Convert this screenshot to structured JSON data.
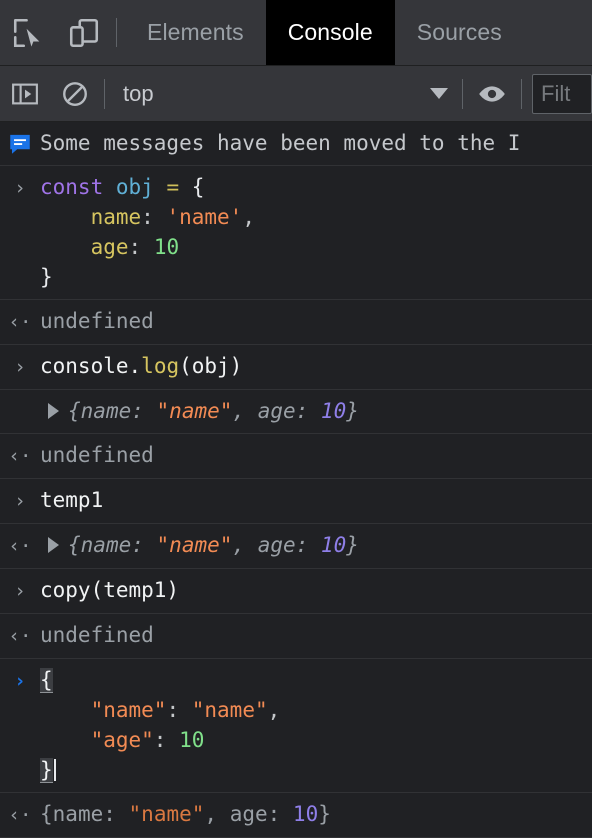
{
  "theme": {
    "bg": "#202124",
    "toolbar_bg": "#35363a",
    "selected_tab_bg": "#000000",
    "accent_blue": "#1a73e8",
    "string_orange": "#f28b54",
    "number_green": "#80e08a",
    "number_purple": "#8f7fe8",
    "key_yellow": "#d6c560",
    "keyword_purple": "#a074e8",
    "variable_blue": "#60b0d6",
    "muted_grey": "#9aa0a6",
    "row_divider": "#313235"
  },
  "tabbar": {
    "icons": [
      {
        "name": "inspect-element-icon",
        "title": "Inspect element"
      },
      {
        "name": "device-toolbar-icon",
        "title": "Toggle device toolbar"
      }
    ],
    "tabs": [
      {
        "label": "Elements",
        "selected": false
      },
      {
        "label": "Console",
        "selected": true
      },
      {
        "label": "Sources",
        "selected": false
      }
    ]
  },
  "toolbar": {
    "sidebar_toggle_icon": "console-sidebar-icon",
    "clear_console_icon": "clear-console-icon",
    "context": {
      "value": "top",
      "dropdown_icon": "chevron-down-icon"
    },
    "live_expression_icon": "eye-icon",
    "filter": {
      "value": "",
      "placeholder": "Filt"
    }
  },
  "info_banner": {
    "icon": "message-bubble-icon",
    "text": "Some messages have been moved to the I"
  },
  "console_rows": [
    {
      "id": "row-input-const-obj",
      "kind": "input",
      "gutter": "›",
      "gutter_style": "grey",
      "lines": [
        [
          {
            "t": "const",
            "c": "t-kw"
          },
          {
            "t": " ",
            "c": "t-plain"
          },
          {
            "t": "obj",
            "c": "t-var"
          },
          {
            "t": " ",
            "c": "t-plain"
          },
          {
            "t": "=",
            "c": "t-op"
          },
          {
            "t": " ",
            "c": "t-plain"
          },
          {
            "t": "{",
            "c": "t-punc"
          }
        ],
        [
          {
            "t": "    ",
            "c": "t-plain"
          },
          {
            "t": "name",
            "c": "t-key"
          },
          {
            "t": ":",
            "c": "t-colon"
          },
          {
            "t": " ",
            "c": "t-plain"
          },
          {
            "t": "'name'",
            "c": "t-str"
          },
          {
            "t": ",",
            "c": "t-colon"
          }
        ],
        [
          {
            "t": "    ",
            "c": "t-plain"
          },
          {
            "t": "age",
            "c": "t-key"
          },
          {
            "t": ":",
            "c": "t-colon"
          },
          {
            "t": " ",
            "c": "t-plain"
          },
          {
            "t": "10",
            "c": "t-num"
          }
        ],
        [
          {
            "t": "}",
            "c": "t-punc"
          }
        ]
      ]
    },
    {
      "id": "row-result-undefined-1",
      "kind": "result",
      "gutter": "‹·",
      "gutter_style": "grey",
      "lines": [
        [
          {
            "t": "undefined",
            "c": "t-undef"
          }
        ]
      ]
    },
    {
      "id": "row-input-console-log",
      "kind": "input",
      "gutter": "›",
      "gutter_style": "grey",
      "lines": [
        [
          {
            "t": "console",
            "c": "t-plain"
          },
          {
            "t": ".",
            "c": "t-plain"
          },
          {
            "t": "log",
            "c": "t-prop"
          },
          {
            "t": "(obj)",
            "c": "t-plain"
          }
        ]
      ]
    },
    {
      "id": "row-output-object-preview",
      "kind": "output",
      "gutter": "",
      "gutter_style": "grey",
      "triangle": true,
      "preview": true,
      "lines": [
        [
          {
            "t": "{",
            "c": "t-pkey"
          },
          {
            "t": "name",
            "c": "t-pkey"
          },
          {
            "t": ": ",
            "c": "t-pkey"
          },
          {
            "t": "\"name\"",
            "c": "t-str"
          },
          {
            "t": ", ",
            "c": "t-pkey"
          },
          {
            "t": "age",
            "c": "t-pkey"
          },
          {
            "t": ": ",
            "c": "t-pkey"
          },
          {
            "t": "10",
            "c": "t-pnum"
          },
          {
            "t": "}",
            "c": "t-pkey"
          }
        ]
      ]
    },
    {
      "id": "row-result-undefined-2",
      "kind": "result",
      "gutter": "‹·",
      "gutter_style": "grey",
      "lines": [
        [
          {
            "t": "undefined",
            "c": "t-undef"
          }
        ]
      ]
    },
    {
      "id": "row-input-temp1",
      "kind": "input",
      "gutter": "›",
      "gutter_style": "grey",
      "lines": [
        [
          {
            "t": "temp1",
            "c": "t-plain"
          }
        ]
      ]
    },
    {
      "id": "row-result-temp1-object",
      "kind": "result",
      "gutter": "‹·",
      "gutter_style": "grey",
      "triangle": true,
      "preview": true,
      "lines": [
        [
          {
            "t": "{",
            "c": "t-pkey"
          },
          {
            "t": "name",
            "c": "t-pkey"
          },
          {
            "t": ": ",
            "c": "t-pkey"
          },
          {
            "t": "\"name\"",
            "c": "t-str"
          },
          {
            "t": ", ",
            "c": "t-pkey"
          },
          {
            "t": "age",
            "c": "t-pkey"
          },
          {
            "t": ": ",
            "c": "t-pkey"
          },
          {
            "t": "10",
            "c": "t-pnum"
          },
          {
            "t": "}",
            "c": "t-pkey"
          }
        ]
      ]
    },
    {
      "id": "row-input-copy-temp1",
      "kind": "input",
      "gutter": "›",
      "gutter_style": "grey",
      "lines": [
        [
          {
            "t": "copy(temp1)",
            "c": "t-plain"
          }
        ]
      ]
    },
    {
      "id": "row-result-undefined-3",
      "kind": "result",
      "gutter": "‹·",
      "gutter_style": "grey",
      "lines": [
        [
          {
            "t": "undefined",
            "c": "t-undef"
          }
        ]
      ]
    },
    {
      "id": "row-prompt-json-input",
      "kind": "prompt",
      "gutter": "›",
      "gutter_style": "blue",
      "lines": [
        [
          {
            "t": "{",
            "c": "brmatch"
          }
        ],
        [
          {
            "t": "    ",
            "c": "t-plain"
          },
          {
            "t": "\"name\"",
            "c": "t-str"
          },
          {
            "t": ":",
            "c": "t-colon"
          },
          {
            "t": " ",
            "c": "t-plain"
          },
          {
            "t": "\"name\"",
            "c": "t-str"
          },
          {
            "t": ",",
            "c": "t-colon"
          }
        ],
        [
          {
            "t": "    ",
            "c": "t-plain"
          },
          {
            "t": "\"age\"",
            "c": "t-str"
          },
          {
            "t": ":",
            "c": "t-colon"
          },
          {
            "t": " ",
            "c": "t-plain"
          },
          {
            "t": "10",
            "c": "t-num"
          }
        ],
        [
          {
            "t": "}",
            "c": "brmatch"
          },
          {
            "t": "CARET",
            "c": "caret"
          }
        ]
      ]
    },
    {
      "id": "row-eager-eval-preview",
      "kind": "eager",
      "gutter": "‹·",
      "gutter_style": "grey",
      "eager": true,
      "lines": [
        [
          {
            "t": "{",
            "c": "t-pkey"
          },
          {
            "t": "name",
            "c": "t-pkey"
          },
          {
            "t": ": ",
            "c": "t-pkey"
          },
          {
            "t": "\"name\"",
            "c": "t-str"
          },
          {
            "t": ", ",
            "c": "t-pkey"
          },
          {
            "t": "age",
            "c": "t-pkey"
          },
          {
            "t": ": ",
            "c": "t-pkey"
          },
          {
            "t": "10",
            "c": "t-pnum"
          },
          {
            "t": "}",
            "c": "t-pkey"
          }
        ]
      ]
    }
  ]
}
